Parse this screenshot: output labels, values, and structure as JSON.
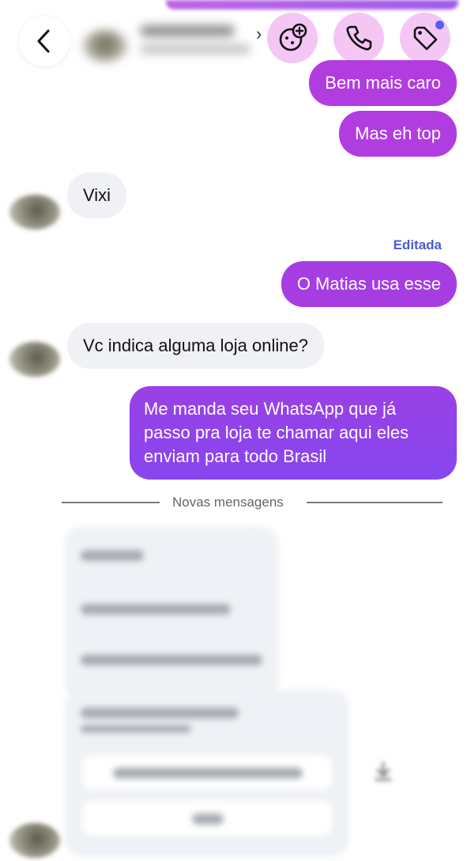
{
  "header": {
    "back_icon": "chevron-left-icon",
    "more_icon": "chevron-right-icon",
    "actions": [
      {
        "name": "add-friend-icon",
        "label": "cookie-plus"
      },
      {
        "name": "phone-icon",
        "label": "call"
      },
      {
        "name": "tag-icon",
        "label": "tag"
      }
    ],
    "notification_dot_color": "#5a5ef0"
  },
  "messages": [
    {
      "side": "out",
      "text": "Bem mais caro"
    },
    {
      "side": "out",
      "text": "Mas eh top"
    },
    {
      "side": "in",
      "text": "Vixi"
    },
    {
      "side": "out",
      "text": "O Matias usa esse",
      "edited_label": "Editada"
    },
    {
      "side": "in",
      "text": "Vc indica alguma loja online?"
    },
    {
      "side": "out",
      "lines": [
        "Me manda seu WhatsApp que já",
        "passo pra loja te chamar aqui eles",
        "enviam para todo Brasil"
      ]
    }
  ],
  "divider": {
    "label": "Novas mensagens"
  },
  "colors": {
    "outgoing_top": "#b13de0",
    "outgoing_bottom": "#8c45ec",
    "incoming": "#eff1f4",
    "accent_text": "#4a5bd0",
    "action_button": "#f3c6f4"
  }
}
